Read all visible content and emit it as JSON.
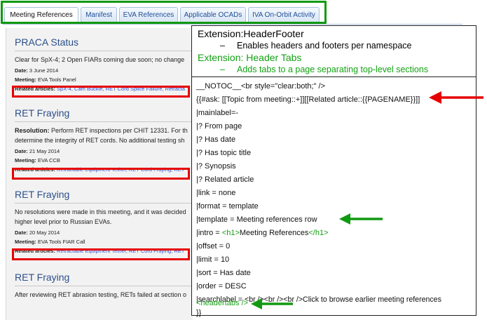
{
  "tabs": [
    {
      "label": "Meeting References",
      "active": true
    },
    {
      "label": "Manifest",
      "active": false
    },
    {
      "label": "EVA References",
      "active": false
    },
    {
      "label": "Applicable OCADs",
      "active": false
    },
    {
      "label": "IVA On-Orbit Activity",
      "active": false
    }
  ],
  "sections": [
    {
      "title": "PRACA Status",
      "text": "Clear for SpX-4; 2 Open FIARs coming due soon; no change",
      "date_label": "Date:",
      "date": "3 June 2014",
      "meeting_label": "Meeting:",
      "meeting": "EVA Tools Panel",
      "related_label": "Related articles:",
      "related": "SpX-4, Cam Buckle, RET Cord Splice Failure, Retracta"
    },
    {
      "title": "RET Fraying",
      "resolution_label": "Resolution:",
      "text": "Perform RET inspections per CHIT 12331. For th",
      "text2": "determine the integrity of RET cords. No additional testing sh",
      "date_label": "Date:",
      "date": "21 May 2014",
      "meeting_label": "Meeting:",
      "meeting": "EVA CCB",
      "related_label": "Related articles:",
      "related": "Retractable Equipment Tether, RET Cord Fraying, RET"
    },
    {
      "title": "RET Fraying",
      "text": "No resolutions were made in this meeting, and it was decided",
      "text2": "higher level prior to Russian EVAs.",
      "date_label": "Date:",
      "date": "20 May 2014",
      "meeting_label": "Meeting:",
      "meeting": "EVA Tools FIAR Call",
      "related_label": "Related articles:",
      "related": "Retractable Equipment Tether, RET Cord Fraying, RET"
    },
    {
      "title": "RET Fraying",
      "text": "After reviewing RET abrasion testing, RETs failed at section o"
    }
  ],
  "callout": {
    "ext1_title": "Extension:HeaderFooter",
    "ext1_dash": "–",
    "ext1_desc": "Enables headers and footers per namespace",
    "ext2_title": "Extension: Header Tabs",
    "ext2_dash": "–",
    "ext2_desc": "Adds tabs to a page separating top-level sections",
    "code": [
      "__NOTOC__<br style=\"clear:both;\" />",
      "{{#ask: [[Topic from meeting::+]][[Related article::{{PAGENAME}}]]",
      "|mainlabel=-",
      "|? From page",
      "|? Has date",
      "|? Has topic title",
      "|? Synopsis",
      "|? Related article",
      "|link = none",
      "|format = template",
      "|template = Meeting references row",
      "|intro = ",
      "|offset = 0",
      "|limit = 10",
      "|sort = Has date",
      "|order = DESC",
      "|searchlabel = <br /><br /><br />Click to browse earlier meeting references",
      "}}"
    ],
    "intro_green": "<h1>",
    "intro_text": "Meeting References",
    "intro_green_close": "</h1>",
    "headertabs": "<headertabs />"
  },
  "colors": {
    "highlight_green": "#119a11",
    "highlight_red": "#e60000",
    "link_blue": "#2a4fd0",
    "title_blue": "#2b4f8a"
  }
}
